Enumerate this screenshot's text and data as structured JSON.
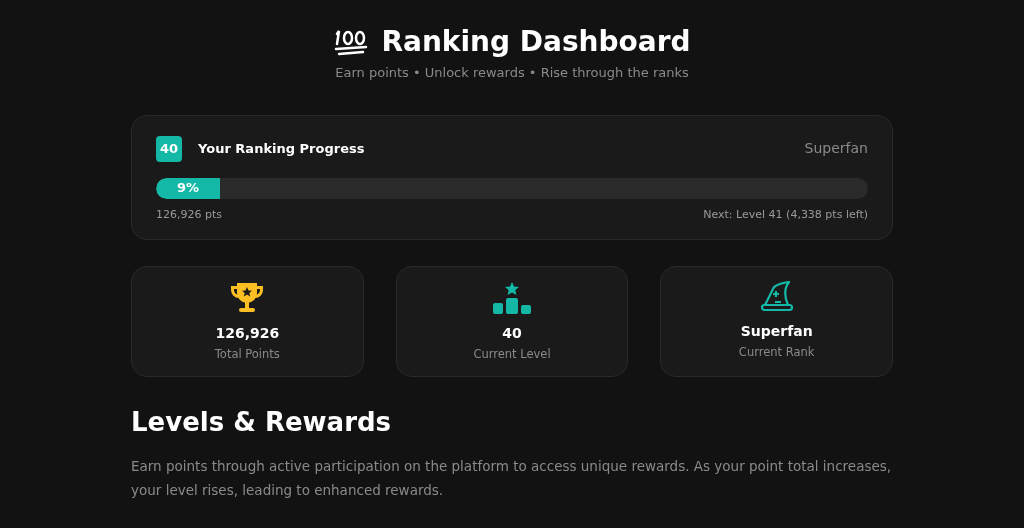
{
  "header": {
    "title": "Ranking Dashboard",
    "subtitle": "Earn points • Unlock rewards • Rise through the ranks"
  },
  "progress": {
    "level_badge": "40",
    "title": "Your Ranking Progress",
    "rank": "Superfan",
    "level": 0.09,
    "percent": "9%",
    "points": "126,926 pts",
    "next": "Next: Level 41 (4,338 pts left)"
  },
  "stats": [
    {
      "kind": "trophy",
      "value": "126,926",
      "label": "Total Points"
    },
    {
      "kind": "podium",
      "value": "40",
      "label": "Current Level"
    },
    {
      "kind": "hat",
      "value": "Superfan",
      "label": "Current Rank"
    }
  ],
  "levels": {
    "heading": "Levels & Rewards",
    "description": "Earn points through active participation on the platform to access unique rewards. As your point total increases, your level rises, leading to enhanced rewards."
  }
}
